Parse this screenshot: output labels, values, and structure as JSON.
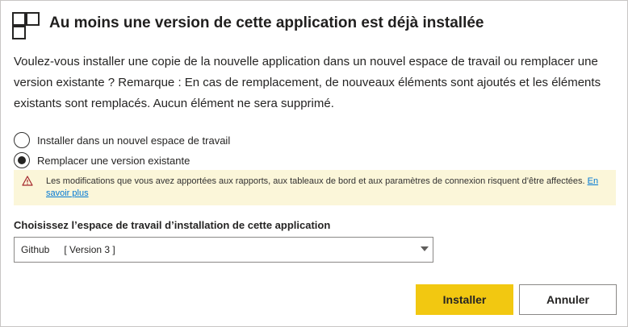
{
  "dialog": {
    "title": "Au moins une version de cette application est déjà installée",
    "description": "Voulez-vous installer une copie de la nouvelle application dans un nouvel espace de travail ou remplacer une version existante ? Remarque : En cas de remplacement, de nouveaux éléments sont ajoutés et les éléments existants sont remplacés. Aucun élément ne sera supprimé.",
    "app_icon": "app-grid-icon"
  },
  "options": [
    {
      "label": "Installer dans un nouvel espace de travail",
      "selected": false
    },
    {
      "label": "Remplacer une version existante",
      "selected": true
    }
  ],
  "warning": {
    "icon": "warning-triangle-icon",
    "text": "Les modifications que vous avez apportées aux rapports, aux tableaux de bord et aux paramètres de connexion risquent d’être affectées.",
    "link": "En savoir plus"
  },
  "workspace": {
    "label": "Choisissez l’espace de travail d’installation de cette application",
    "selected_workspace": "Github",
    "selected_version": "[ Version 3 ]"
  },
  "buttons": {
    "install": "Installer",
    "cancel": "Annuler"
  },
  "colors": {
    "primary": "#f2c811",
    "warning_bg": "#fbf6d9",
    "warning_icon": "#a4262c",
    "link": "#0078d4"
  }
}
